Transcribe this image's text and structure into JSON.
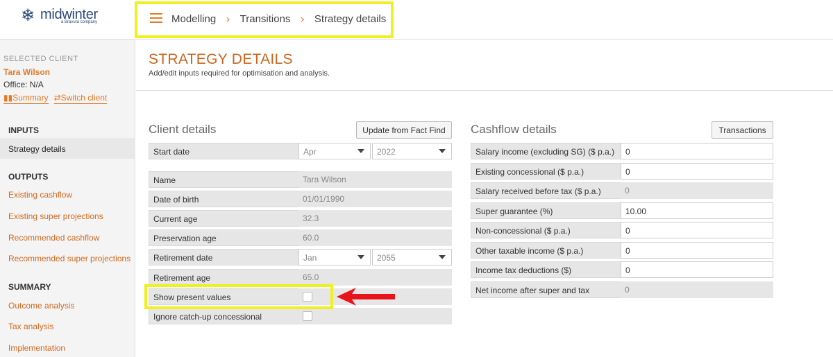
{
  "header": {
    "logo": {
      "brand": "midwinter",
      "tagline": "a Bravura company"
    },
    "breadcrumbs": [
      "Modelling",
      "Transitions",
      "Strategy details"
    ]
  },
  "sidebar": {
    "selected_label": "SELECTED CLIENT",
    "client_name": "Tara Wilson",
    "office": "Office: N/A",
    "summary_link": "Summary",
    "switch_link": "Switch client",
    "inputs_heading": "INPUTS",
    "inputs_items": [
      "Strategy details"
    ],
    "outputs_heading": "OUTPUTS",
    "outputs_items": [
      "Existing cashflow",
      "Existing super projections",
      "Recommended cashflow",
      "Recommended super projections"
    ],
    "summary_heading": "SUMMARY",
    "summary_items": [
      "Outcome analysis",
      "Tax analysis",
      "Implementation"
    ]
  },
  "main": {
    "title": "STRATEGY DETAILS",
    "subtitle": "Add/edit inputs required for optimisation and analysis.",
    "client_details": {
      "heading": "Client details",
      "update_button": "Update from Fact Find",
      "start_date": {
        "label": "Start date",
        "month": "Apr",
        "year": "2022"
      },
      "name": {
        "label": "Name",
        "value": "Tara Wilson"
      },
      "dob": {
        "label": "Date of birth",
        "value": "01/01/1990"
      },
      "current_age": {
        "label": "Current age",
        "value": "32.3"
      },
      "preservation_age": {
        "label": "Preservation age",
        "value": "60.0"
      },
      "retirement_date": {
        "label": "Retirement date",
        "month": "Jan",
        "year": "2055"
      },
      "retirement_age": {
        "label": "Retirement age",
        "value": "65.0"
      },
      "show_present_values": {
        "label": "Show present values",
        "checked": false
      },
      "ignore_catchup": {
        "label": "Ignore catch-up concessional",
        "checked": false
      }
    },
    "cashflow_details": {
      "heading": "Cashflow details",
      "transactions_button": "Transactions",
      "rows": [
        {
          "label": "Salary income (excluding SG) ($ p.a.)",
          "value": "0",
          "editable": true
        },
        {
          "label": "Existing concessional ($ p.a.)",
          "value": "0",
          "editable": true
        },
        {
          "label": "Salary received before tax ($ p.a.)",
          "value": "0",
          "editable": false
        },
        {
          "label": "Super guarantee (%)",
          "value": "10.00",
          "editable": true
        },
        {
          "label": "Non-concessional ($ p.a.)",
          "value": "0",
          "editable": true
        },
        {
          "label": "Other taxable income ($ p.a.)",
          "value": "0",
          "editable": true
        },
        {
          "label": "Income tax deductions ($)",
          "value": "0",
          "editable": true
        },
        {
          "label": "Net income after super and tax",
          "value": "0",
          "editable": false
        }
      ]
    }
  },
  "colors": {
    "accent": "#e07b2a",
    "title": "#c9661f",
    "highlight": "#f0f020",
    "arrow": "#e8141c"
  }
}
